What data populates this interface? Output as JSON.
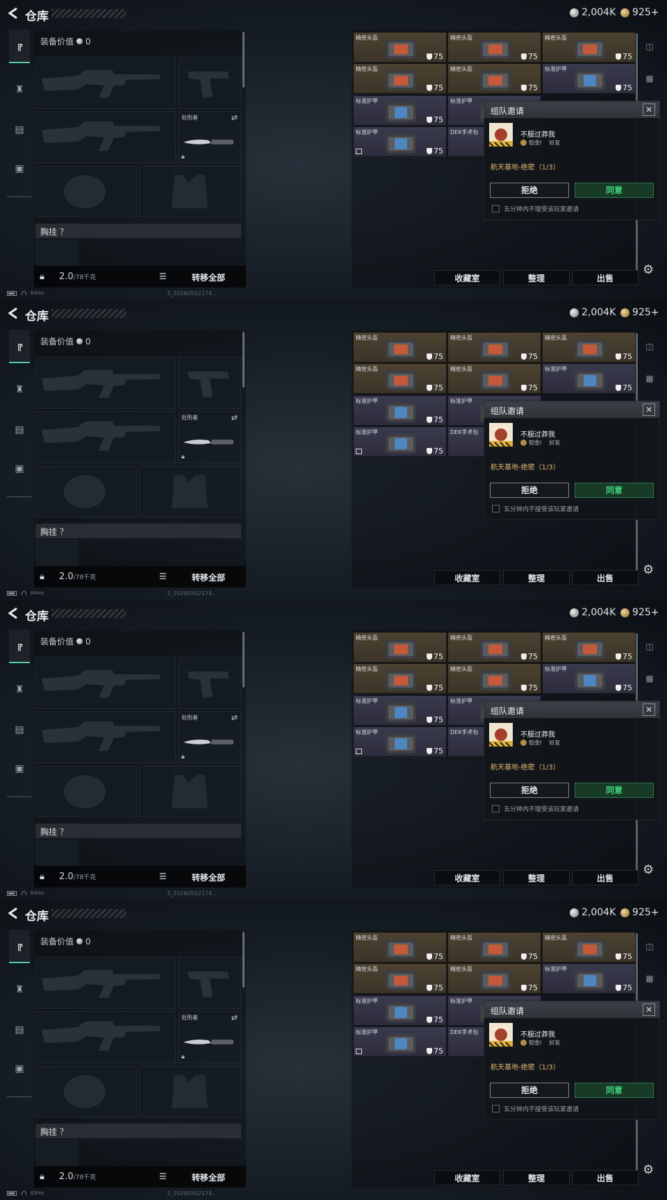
{
  "frames": [
    {
      "latency": "64ms"
    },
    {
      "latency": "64ms"
    },
    {
      "latency": "63ms"
    },
    {
      "latency": "63ms"
    }
  ],
  "header": {
    "title": "仓库",
    "silver": "2,004K",
    "gold": "925+"
  },
  "equipment": {
    "value_label": "装备价值",
    "value": "0",
    "knife_name": "处刑者",
    "chest_label": "胸挂 ？",
    "weight": "2.0",
    "weight_cap": "/78千克",
    "transfer_all": "转移全部"
  },
  "storage": {
    "items": [
      {
        "label": "精密头盔",
        "value": "75",
        "type": "gold"
      },
      {
        "label": "精密头盔",
        "value": "75",
        "type": "gold"
      },
      {
        "label": "精密头盔",
        "value": "75",
        "type": "gold"
      },
      {
        "label": "精密头盔",
        "value": "75",
        "type": "gold"
      },
      {
        "label": "精密头盔",
        "value": "75",
        "type": "gold"
      },
      {
        "label": "标准护甲",
        "value": "75",
        "type": "purple"
      },
      {
        "label": "标准护甲",
        "value": "75",
        "type": "purple"
      },
      {
        "label": "标准护甲",
        "value": "",
        "type": "purple"
      },
      {
        "label": "标准护甲",
        "value": "75",
        "type": "purple"
      },
      {
        "label": "DEK手术包",
        "value": "",
        "type": "purple"
      }
    ],
    "buttons": {
      "collection": "收藏室",
      "sort": "整理",
      "sell": "出售"
    }
  },
  "invite": {
    "title": "组队邀请",
    "player": "不服过莽我",
    "rank": "铂金I",
    "relation": "好友",
    "mode": "航天基地-绝密（1/3）",
    "refuse": "拒绝",
    "agree": "同意",
    "mute_label": "五分钟内不接受该玩家邀请"
  },
  "status": {
    "timestamp": "3_20260502174..."
  }
}
